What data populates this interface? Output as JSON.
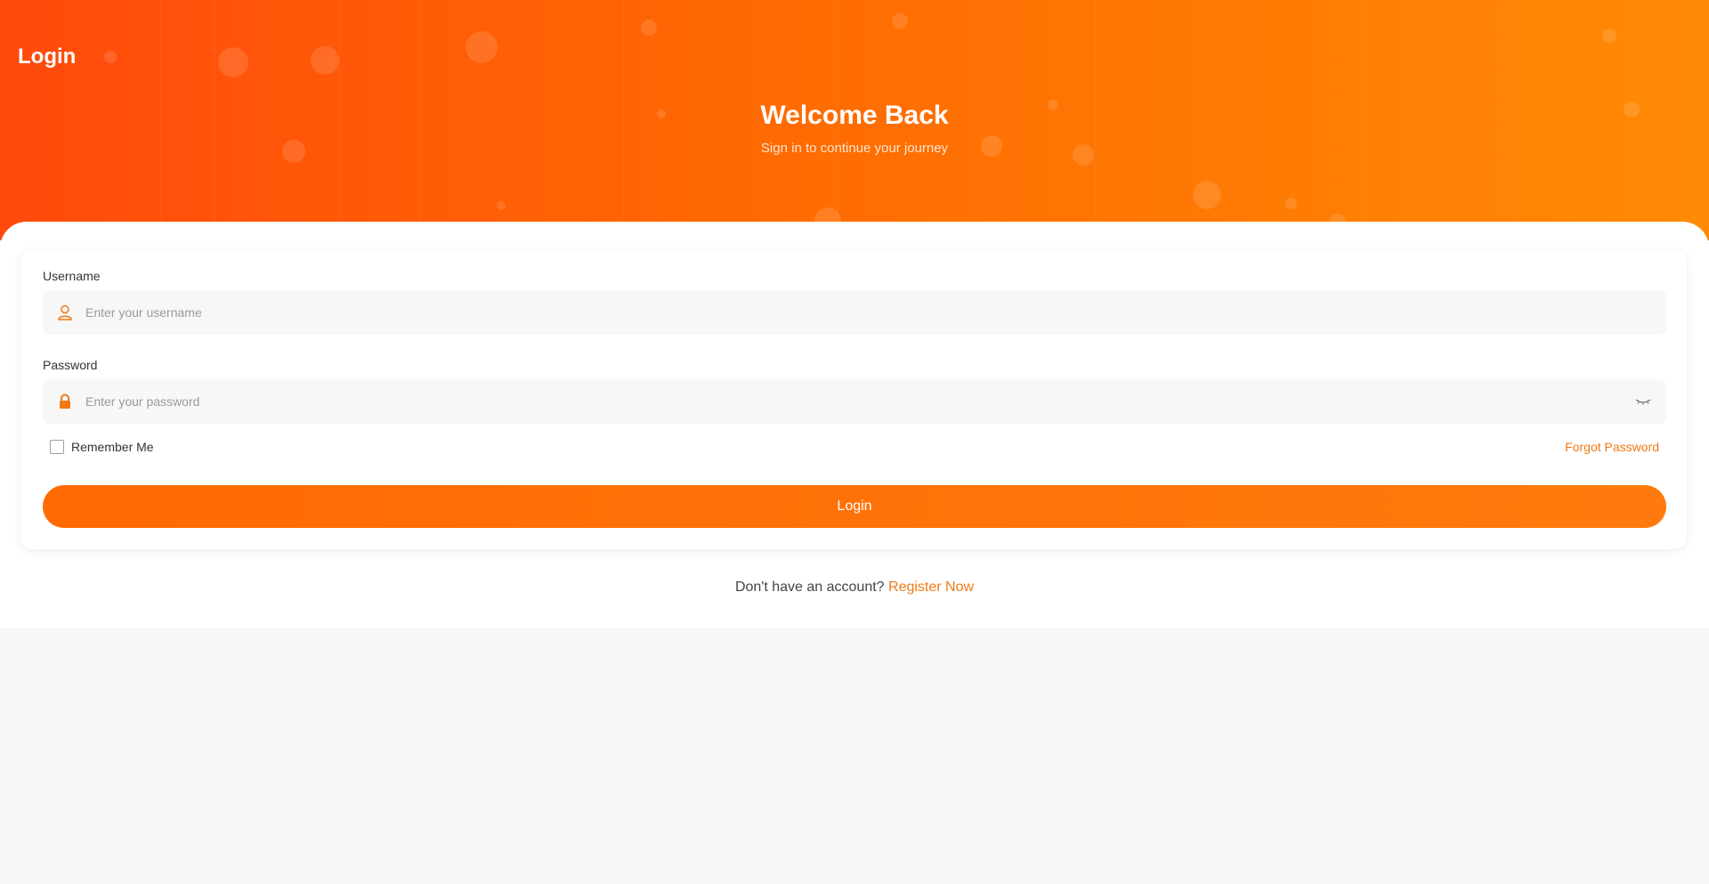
{
  "header": {
    "page_title": "Login",
    "welcome_title": "Welcome Back",
    "subtitle": "Sign in to continue your journey"
  },
  "form": {
    "username_label": "Username",
    "username_placeholder": "Enter your username",
    "password_label": "Password",
    "password_placeholder": "Enter your password",
    "remember_label": "Remember Me",
    "remember_checked": false,
    "forgot_label": "Forgot Password",
    "login_label": "Login"
  },
  "footer": {
    "prompt": "Don't have an account?",
    "register_label": "Register Now"
  },
  "colors": {
    "accent": "#ff6a02",
    "link": "#f07a14",
    "gradient_start": "#ff4a0c",
    "gradient_end": "#ff8a05"
  },
  "icons": {
    "username": "user-icon",
    "password": "lock-icon",
    "toggle": "eye-closed-icon"
  }
}
